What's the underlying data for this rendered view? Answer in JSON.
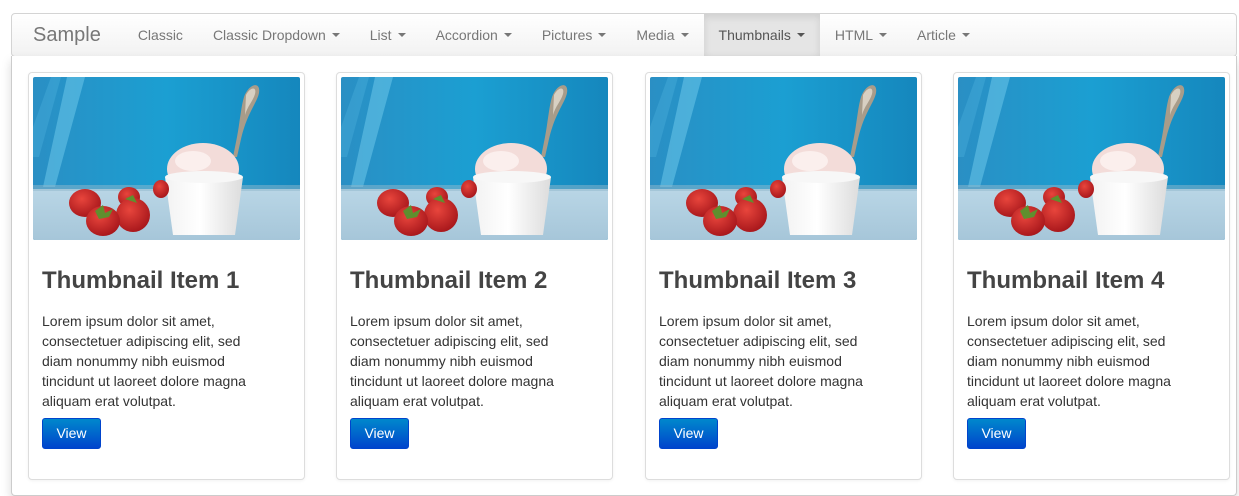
{
  "navbar": {
    "brand": "Sample",
    "items": [
      {
        "label": "Classic",
        "dropdown": false,
        "active": false
      },
      {
        "label": "Classic Dropdown",
        "dropdown": true,
        "active": false
      },
      {
        "label": "List",
        "dropdown": true,
        "active": false
      },
      {
        "label": "Accordion",
        "dropdown": true,
        "active": false
      },
      {
        "label": "Pictures",
        "dropdown": true,
        "active": false
      },
      {
        "label": "Media",
        "dropdown": true,
        "active": false
      },
      {
        "label": "Thumbnails",
        "dropdown": true,
        "active": true
      },
      {
        "label": "HTML",
        "dropdown": true,
        "active": false
      },
      {
        "label": "Article",
        "dropdown": true,
        "active": false
      }
    ]
  },
  "thumbnails": [
    {
      "title": "Thumbnail Item 1",
      "text": "Lorem ipsum dolor sit amet, consectetuer adipiscing elit, sed diam nonummy nibh euismod tincidunt ut laoreet dolore magna aliquam erat volutpat.",
      "button": "View"
    },
    {
      "title": "Thumbnail Item 2",
      "text": "Lorem ipsum dolor sit amet, consectetuer adipiscing elit, sed diam nonummy nibh euismod tincidunt ut laoreet dolore magna aliquam erat volutpat.",
      "button": "View"
    },
    {
      "title": "Thumbnail Item 3",
      "text": "Lorem ipsum dolor sit amet, consectetuer adipiscing elit, sed diam nonummy nibh euismod tincidunt ut laoreet dolore magna aliquam erat volutpat.",
      "button": "View"
    },
    {
      "title": "Thumbnail Item 4",
      "text": "Lorem ipsum dolor sit amet, consectetuer adipiscing elit, sed diam nonummy nibh euismod tincidunt ut laoreet dolore magna aliquam erat volutpat.",
      "button": "View"
    }
  ],
  "colors": {
    "button_top": "#0088cc",
    "button_bottom": "#0044cc",
    "photo_background": "#1b9fd2",
    "nav_text": "#777777"
  }
}
